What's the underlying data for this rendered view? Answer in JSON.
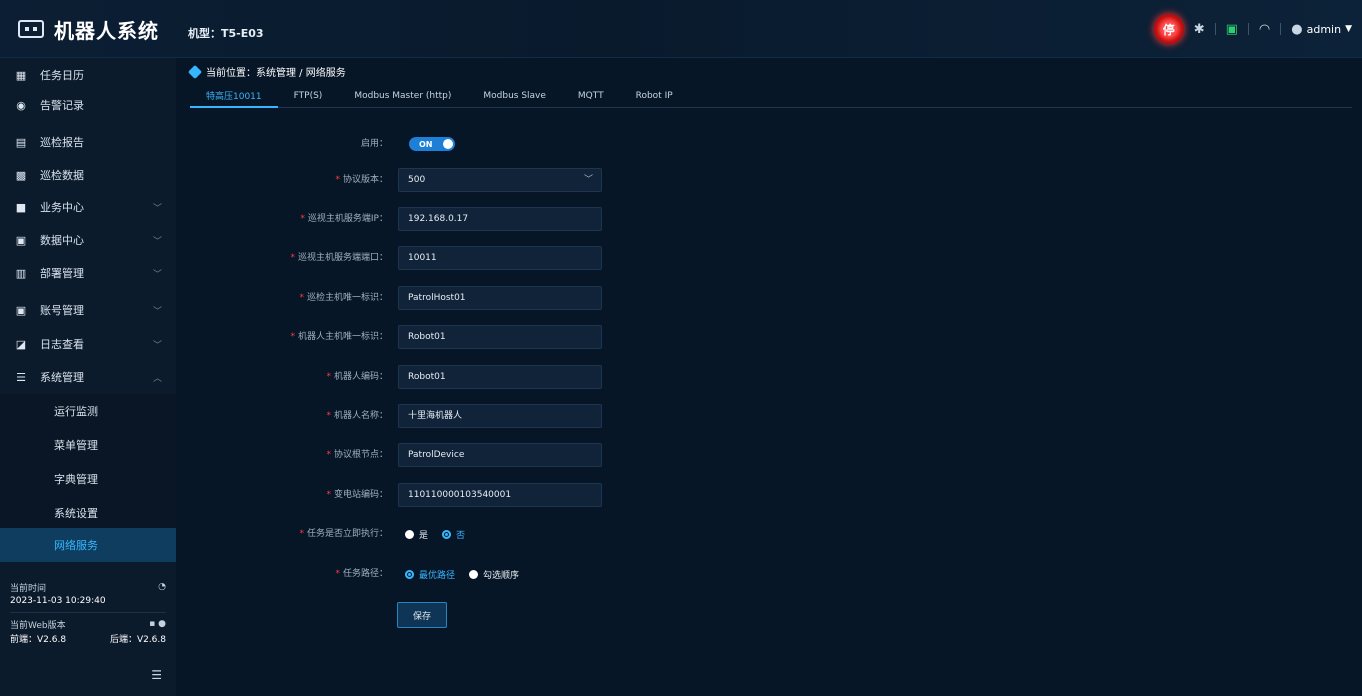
{
  "app": {
    "logo_text": "机器人系统",
    "model": "机型：T5-E03"
  },
  "header": {
    "estop_label": "停",
    "user": "admin"
  },
  "sidebar": {
    "items": [
      {
        "label": "任务日历",
        "icon": "calendar-icon"
      },
      {
        "label": "告警记录",
        "icon": "alarm-icon"
      },
      {
        "label": "巡检报告",
        "icon": "report-icon"
      },
      {
        "label": "巡检数据",
        "icon": "data-icon"
      },
      {
        "label": "业务中心",
        "icon": "folder-icon"
      },
      {
        "label": "数据中心",
        "icon": "monitor-icon"
      },
      {
        "label": "部署管理",
        "icon": "deploy-icon"
      },
      {
        "label": "账号管理",
        "icon": "account-icon"
      },
      {
        "label": "日志查看",
        "icon": "log-icon"
      },
      {
        "label": "系统管理",
        "icon": "system-icon"
      }
    ],
    "sub_items": [
      "运行监测",
      "菜单管理",
      "字典管理",
      "系统设置",
      "网络服务"
    ],
    "info": {
      "time_label": "当前时间",
      "time_value": "2023-11-03 10:29:40",
      "version_label": "当前Web版本",
      "front_version": "前端：V2.6.8",
      "back_version": "后端：V2.6.8"
    }
  },
  "breadcrumb": "当前位置：系统管理 / 网络服务",
  "tabs": [
    "特高压10011",
    "FTP(S)",
    "Modbus Master (http)",
    "Modbus Slave",
    "MQTT",
    "Robot IP"
  ],
  "form": {
    "enable_label": "启用：",
    "enable_state": "ON",
    "protocol_version_label": "协议版本：",
    "protocol_version": "500",
    "server_ip_label": "巡视主机服务端IP：",
    "server_ip": "192.168.0.17",
    "server_port_label": "巡视主机服务端端口：",
    "server_port": "10011",
    "host_id_label": "巡检主机唯一标识：",
    "host_id": "PatrolHost01",
    "robot_host_id_label": "机器人主机唯一标识：",
    "robot_host_id": "Robot01",
    "robot_code_label": "机器人编码：",
    "robot_code": "Robot01",
    "robot_name_label": "机器人名称：",
    "robot_name": "十里海机器人",
    "root_node_label": "协议根节点：",
    "root_node": "PatrolDevice",
    "station_code_label": "变电站编码：",
    "station_code": "110110000103540001",
    "immediate_label": "任务是否立即执行：",
    "immediate_yes": "是",
    "immediate_no": "否",
    "path_label": "任务路径：",
    "path_optimal": "最优路径",
    "path_order": "勾选顺序",
    "save_label": "保存"
  },
  "colors": {
    "accent": "#37b6ff",
    "required": "#ff3b3b",
    "estop": "#e52222"
  }
}
